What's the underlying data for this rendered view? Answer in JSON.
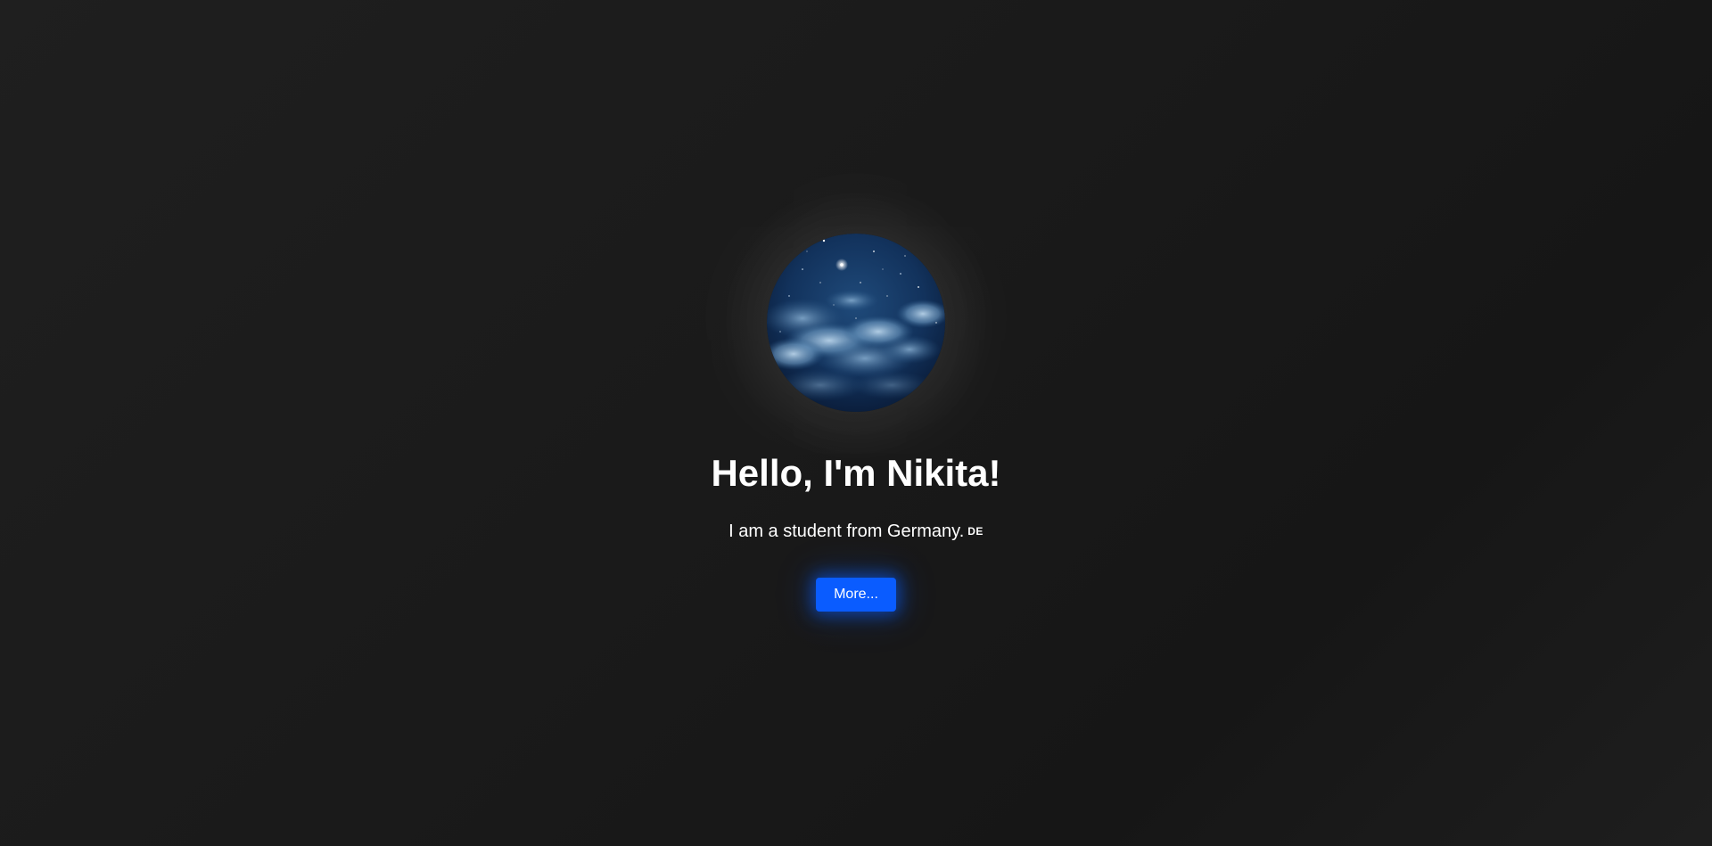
{
  "hero": {
    "avatar_alt": "Night sky with clouds and stars",
    "title": "Hello, I'm Nikita!",
    "subtitle": "I am a student from Germany.",
    "flag_label": "DE",
    "flag_icon": "germany-flag-icon",
    "button_label": "More..."
  },
  "colors": {
    "background": "#1a1a1a",
    "text": "#ffffff",
    "accent": "#0a5cff"
  }
}
